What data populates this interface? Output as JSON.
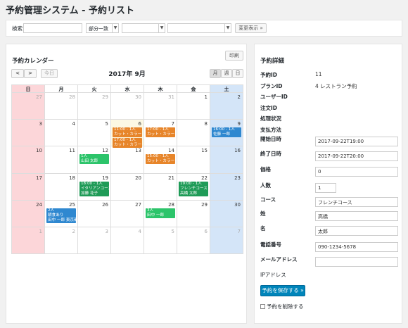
{
  "page": {
    "title": "予約管理システム - 予約リスト"
  },
  "search": {
    "label": "検索",
    "input_value": "",
    "match_select": "部分一致",
    "select2_value": "",
    "select3_value": "",
    "change_button": "変更表示 »"
  },
  "calendar": {
    "title": "予約カレンダー",
    "print_button": "印刷",
    "prev_label": "<",
    "next_label": ">",
    "today_button": "今日",
    "month_title": "2017年 9月",
    "views": {
      "month": "月",
      "week": "週",
      "day": "日"
    },
    "weekdays": [
      "日",
      "月",
      "火",
      "水",
      "木",
      "金",
      "土"
    ],
    "weeks": [
      [
        {
          "d": "27",
          "o": true
        },
        {
          "d": "28",
          "o": true
        },
        {
          "d": "29",
          "o": true
        },
        {
          "d": "30",
          "o": true
        },
        {
          "d": "31",
          "o": true
        },
        {
          "d": "1"
        },
        {
          "d": "2"
        }
      ],
      [
        {
          "d": "3"
        },
        {
          "d": "4"
        },
        {
          "d": "5"
        },
        {
          "d": "6",
          "today": true
        },
        {
          "d": "7"
        },
        {
          "d": "8"
        },
        {
          "d": "9"
        }
      ],
      [
        {
          "d": "10"
        },
        {
          "d": "11"
        },
        {
          "d": "12"
        },
        {
          "d": "13"
        },
        {
          "d": "14"
        },
        {
          "d": "15"
        },
        {
          "d": "16"
        }
      ],
      [
        {
          "d": "17"
        },
        {
          "d": "18"
        },
        {
          "d": "19"
        },
        {
          "d": "20"
        },
        {
          "d": "21"
        },
        {
          "d": "22"
        },
        {
          "d": "23"
        }
      ],
      [
        {
          "d": "24"
        },
        {
          "d": "25"
        },
        {
          "d": "26"
        },
        {
          "d": "27"
        },
        {
          "d": "28"
        },
        {
          "d": "29"
        },
        {
          "d": "30"
        }
      ],
      [
        {
          "d": "1",
          "o": true
        },
        {
          "d": "2",
          "o": true
        },
        {
          "d": "3",
          "o": true
        },
        {
          "d": "4",
          "o": true
        },
        {
          "d": "5",
          "o": true
        },
        {
          "d": "6",
          "o": true
        },
        {
          "d": "7",
          "o": true
        }
      ]
    ],
    "events": [
      {
        "w": 1,
        "c": 3,
        "slot": 0,
        "color": "orange",
        "l1": "11:00 - 1人",
        "l2": "カット・カラー（共）"
      },
      {
        "w": 1,
        "c": 3,
        "slot": 1,
        "color": "orange",
        "l1": "17:00 - 1人",
        "l2": "カット・カラー・パ"
      },
      {
        "w": 1,
        "c": 4,
        "slot": 0,
        "color": "orange",
        "l1": "17:00 - 1人",
        "l2": "カット・カラー"
      },
      {
        "w": 1,
        "c": 6,
        "slot": 0,
        "color": "blue",
        "l1": "16:00 - 1人",
        "l2": "佐藤 一郎"
      },
      {
        "w": 2,
        "c": 2,
        "slot": 0,
        "color": "green",
        "l1": "1人",
        "l2": "山田 太郎"
      },
      {
        "w": 2,
        "c": 4,
        "slot": 0,
        "color": "orange",
        "l1": "15:00 - 1人",
        "l2": "カット・カラー（共）"
      },
      {
        "w": 3,
        "c": 2,
        "slot": 0,
        "color": "dgreen",
        "l1": "18:00 - 1人",
        "l2": "イタリアンコース",
        "l3": "加藤 花子"
      },
      {
        "w": 3,
        "c": 5,
        "slot": 0,
        "color": "dgreen",
        "l1": "19:00 - 1人",
        "l2": "フレンチコース",
        "l3": "高橋 太郎"
      },
      {
        "w": 4,
        "c": 1,
        "slot": 0,
        "color": "blue",
        "l1": "2人",
        "l2": "朝食あり",
        "l3": "田中 一郎 東京都"
      },
      {
        "w": 4,
        "c": 4,
        "slot": 0,
        "color": "green",
        "l1": "3人",
        "l2": "田中 一郎"
      }
    ]
  },
  "detail": {
    "title": "予約詳細",
    "rows": [
      {
        "label": "予約ID",
        "value": "11"
      },
      {
        "label": "プランID",
        "value": "4 レストラン予約"
      },
      {
        "label": "ユーザーID",
        "value": ""
      },
      {
        "label": "注文ID",
        "value": ""
      },
      {
        "label": "処理状況",
        "value": ""
      },
      {
        "label": "支払方法",
        "value": ""
      }
    ],
    "inputs": [
      {
        "label": "開始日時",
        "value": "2017-09-22T19:00"
      },
      {
        "label": "終了日時",
        "value": "2017-09-22T20:00"
      },
      {
        "label": "価格",
        "value": "0"
      },
      {
        "label": "人数",
        "value": "1"
      },
      {
        "label": "コース",
        "value": "フレンチコース"
      },
      {
        "label": "姓",
        "value": "高橋"
      },
      {
        "label": "名",
        "value": "太郎"
      },
      {
        "label": "電話番号",
        "value": "090-1234-5678"
      },
      {
        "label": "メールアドレス",
        "value": ""
      }
    ],
    "ip_label": "IPアドレス",
    "save_button": "予約を保存する »",
    "delete_label": "予約を削除する"
  }
}
